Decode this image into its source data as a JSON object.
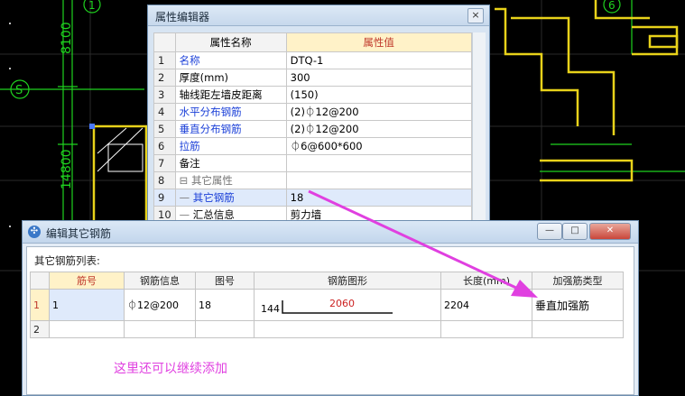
{
  "cad_labels": {
    "dim_top": "8100",
    "dim_mid": "14800",
    "axis_s": "S",
    "axis_top": "1",
    "axis_right": "6"
  },
  "property_editor": {
    "title": "属性编辑器",
    "close": "×",
    "header": {
      "name": "属性名称",
      "value": "属性值"
    },
    "rows": [
      {
        "num": "1",
        "name": "名称",
        "value": "DTQ-1",
        "style": "blue",
        "tree": ""
      },
      {
        "num": "2",
        "name": "厚度(mm)",
        "value": "300",
        "style": "",
        "tree": ""
      },
      {
        "num": "3",
        "name": "轴线距左墙皮距离",
        "value": "(150)",
        "style": "",
        "tree": ""
      },
      {
        "num": "4",
        "name": "水平分布钢筋",
        "value": "(2)⏀12@200",
        "style": "blue",
        "tree": ""
      },
      {
        "num": "5",
        "name": "垂直分布钢筋",
        "value": "(2)⏀12@200",
        "style": "blue",
        "tree": ""
      },
      {
        "num": "6",
        "name": "拉筋",
        "value": "⏀6@600*600",
        "style": "blue",
        "tree": ""
      },
      {
        "num": "7",
        "name": "备注",
        "value": "",
        "style": "",
        "tree": ""
      },
      {
        "num": "8",
        "name": "其它属性",
        "value": "",
        "style": "gray",
        "tree": "⊟ "
      },
      {
        "num": "9",
        "name": "其它钢筋",
        "value": "18",
        "style": "sel",
        "tree": "— "
      },
      {
        "num": "10",
        "name": "汇总信息",
        "value": "剪力墙",
        "style": "",
        "tree": "— "
      }
    ]
  },
  "rebar_editor": {
    "title": "编辑其它钢筋",
    "buttons": {
      "minimize": "—",
      "maximize": "□",
      "close": "✕"
    },
    "list_label": "其它钢筋列表:",
    "columns": [
      "筋号",
      "钢筋信息",
      "图号",
      "钢筋图形",
      "长度(mm)",
      "加强筋类型"
    ],
    "rows": [
      {
        "num": "1",
        "bar_no": "1",
        "info": "⏀12@200",
        "figure_no": "18",
        "shape_left": "144",
        "shape_mid": "2060",
        "length": "2204",
        "type": "垂直加强筋"
      },
      {
        "num": "2",
        "bar_no": "",
        "info": "",
        "figure_no": "",
        "shape_left": "",
        "shape_mid": "",
        "length": "",
        "type": ""
      }
    ]
  },
  "annotation": {
    "hint": "这里还可以继续添加",
    "color": "#e040e0"
  }
}
